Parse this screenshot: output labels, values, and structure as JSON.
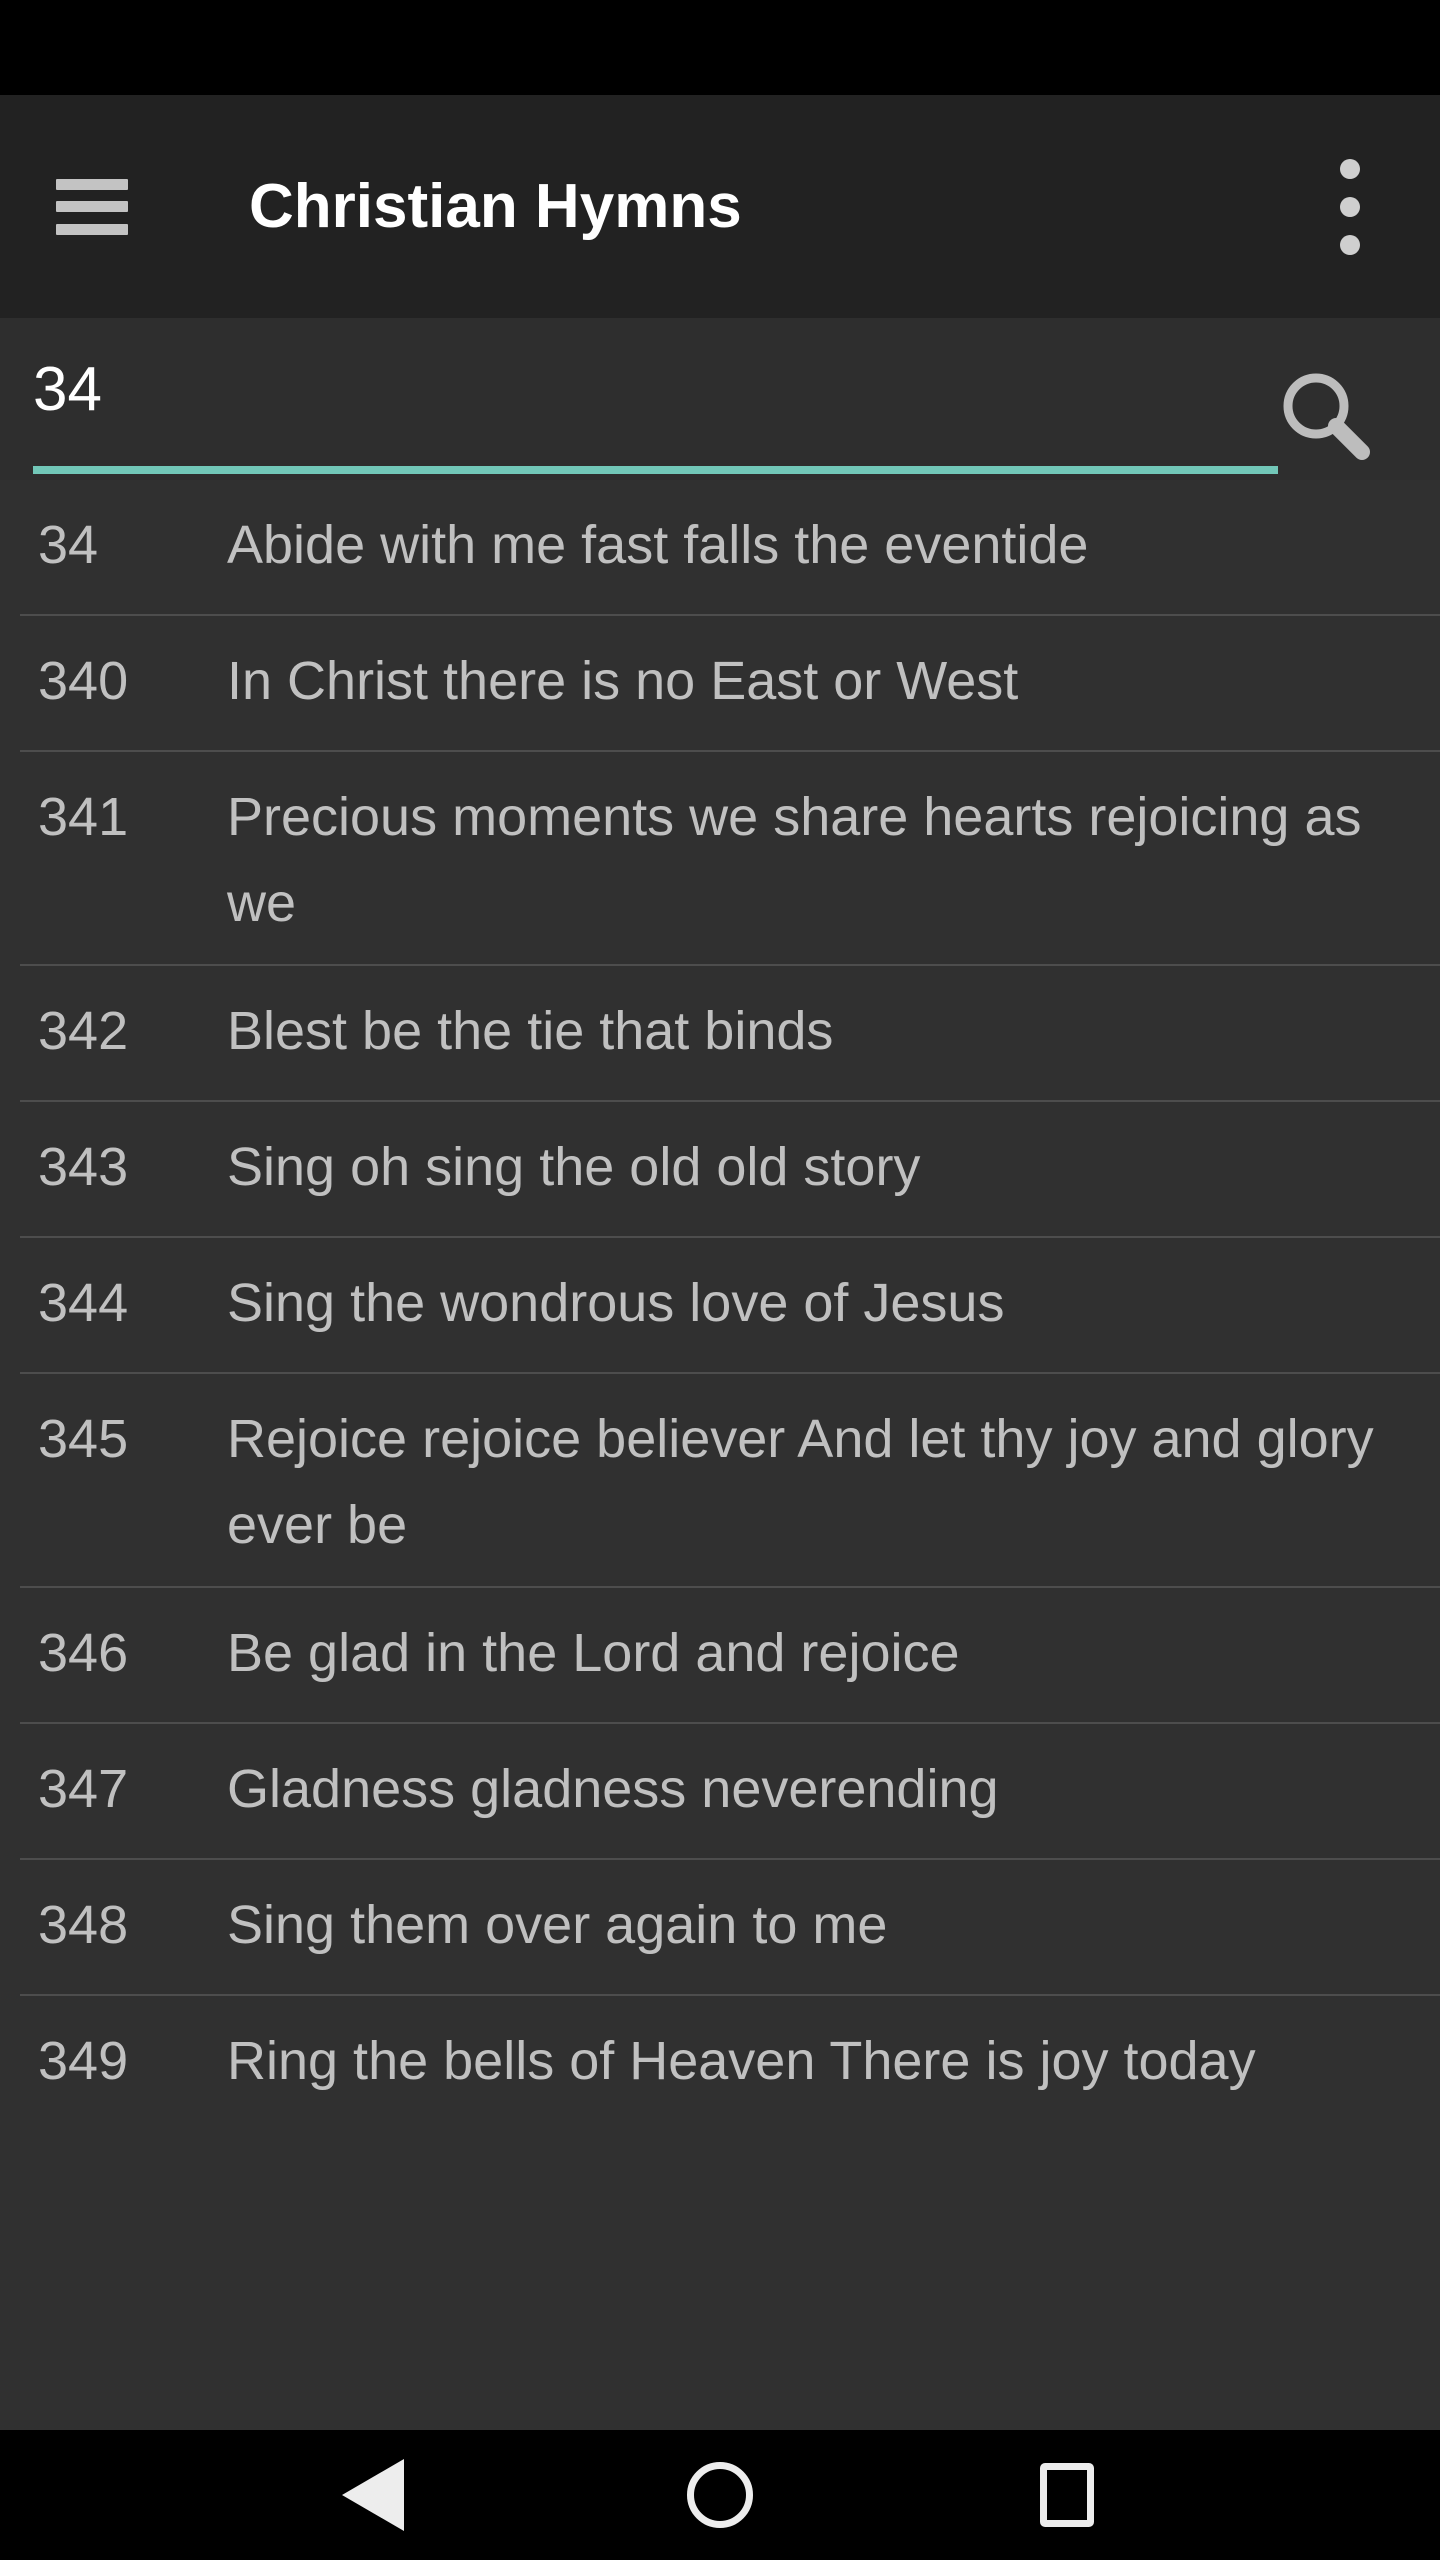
{
  "status_bar": {
    "background": "#000000"
  },
  "app_bar": {
    "title": "Christian Hymns",
    "menu_icon": "hamburger-icon",
    "overflow_icon": "more-vertical-icon",
    "background": "#222222"
  },
  "search": {
    "value": "34",
    "placeholder": "",
    "icon": "search-icon",
    "underline_color": "#72c7b8",
    "background": "#2e2e2e"
  },
  "list": {
    "background": "#303030",
    "divider_color": "#4d4d4d",
    "text_color": "#c0c0c0",
    "rows": [
      {
        "number": "34",
        "title": "Abide with me fast falls the eventide"
      },
      {
        "number": "340",
        "title": "In Christ there is no East or West"
      },
      {
        "number": "341",
        "title": "Precious moments we share hearts rejoicing as we"
      },
      {
        "number": "342",
        "title": "Blest be the tie that binds"
      },
      {
        "number": "343",
        "title": "Sing oh sing the old old story"
      },
      {
        "number": "344",
        "title": "Sing the wondrous love of Jesus"
      },
      {
        "number": "345",
        "title": "Rejoice rejoice believer And let thy joy and glory ever be"
      },
      {
        "number": "346",
        "title": "Be glad in the Lord and rejoice"
      },
      {
        "number": "347",
        "title": "Gladness gladness neverending"
      },
      {
        "number": "348",
        "title": "Sing them over again to me"
      },
      {
        "number": "349",
        "title": "Ring the bells of Heaven There is joy today"
      }
    ]
  },
  "nav_bar": {
    "background": "#000000",
    "buttons": [
      {
        "name": "back-button",
        "icon": "triangle-left-icon"
      },
      {
        "name": "home-button",
        "icon": "circle-icon"
      },
      {
        "name": "recents-button",
        "icon": "square-icon"
      }
    ]
  }
}
